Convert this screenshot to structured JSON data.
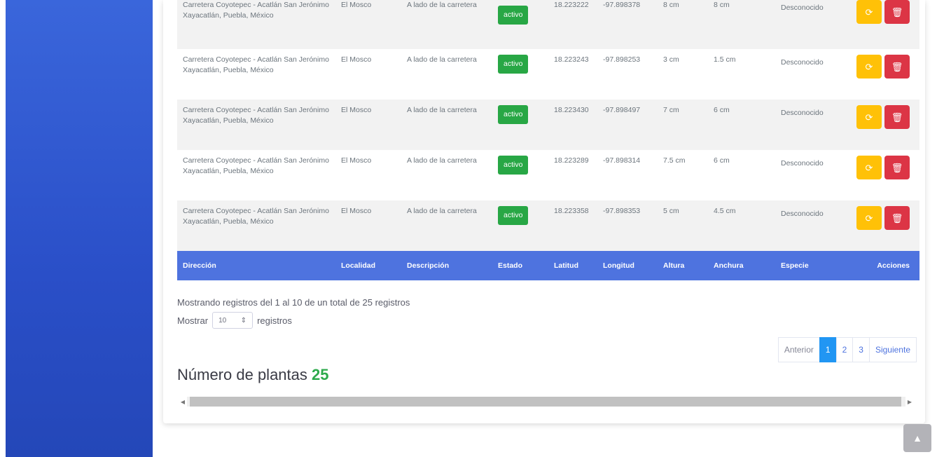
{
  "table": {
    "rows": [
      {
        "direccion": "Carretera Coyotepec - Acatlán San Jerónimo Xayacatlán, Puebla, México",
        "localidad": "El Mosco",
        "descripcion": "A lado de la carretera",
        "estado": "activo",
        "latitud": "18.223222",
        "longitud": "-97.898378",
        "altura": "8 cm",
        "anchura": "8 cm",
        "especie": "Desconocido"
      },
      {
        "direccion": "Carretera Coyotepec - Acatlán San Jerónimo Xayacatlán, Puebla, México",
        "localidad": "El Mosco",
        "descripcion": "A lado de la carretera",
        "estado": "activo",
        "latitud": "18.223243",
        "longitud": "-97.898253",
        "altura": "3 cm",
        "anchura": "1.5 cm",
        "especie": "Desconocido"
      },
      {
        "direccion": "Carretera Coyotepec - Acatlán San Jerónimo Xayacatlán, Puebla, México",
        "localidad": "El Mosco",
        "descripcion": "A lado de la carretera",
        "estado": "activo",
        "latitud": "18.223430",
        "longitud": "-97.898497",
        "altura": "7 cm",
        "anchura": "6 cm",
        "especie": "Desconocido"
      },
      {
        "direccion": "Carretera Coyotepec - Acatlán San Jerónimo Xayacatlán, Puebla, México",
        "localidad": "El Mosco",
        "descripcion": "A lado de la carretera",
        "estado": "activo",
        "latitud": "18.223289",
        "longitud": "-97.898314",
        "altura": "7.5 cm",
        "anchura": "6 cm",
        "especie": "Desconocido"
      },
      {
        "direccion": "Carretera Coyotepec - Acatlán San Jerónimo Xayacatlán, Puebla, México",
        "localidad": "El Mosco",
        "descripcion": "A lado de la carretera",
        "estado": "activo",
        "latitud": "18.223358",
        "longitud": "-97.898353",
        "altura": "5 cm",
        "anchura": "4.5 cm",
        "especie": "Desconocido"
      }
    ],
    "headers": [
      "Dirección",
      "Localidad",
      "Descripción",
      "Estado",
      "Latitud",
      "Longitud",
      "Altura",
      "Anchura",
      "Especie",
      "Acciones"
    ],
    "edit_icon": "refresh-icon",
    "delete_icon": "trash-icon"
  },
  "info": "Mostrando registros del 1 al 10 de un total de 25 registros",
  "length": {
    "before": "Mostrar",
    "value": "10",
    "after": "registros"
  },
  "pagination": {
    "prev": "Anterior",
    "pages": [
      "1",
      "2",
      "3"
    ],
    "next": "Siguiente"
  },
  "count": {
    "label": "Número de plantas",
    "value": "25"
  },
  "colors": {
    "sidebar": "#2a4fc8",
    "header": "#4e73df",
    "badge": "#28a745",
    "warn": "#ffc107",
    "danger": "#dc3545",
    "active_page": "#2196f3"
  }
}
